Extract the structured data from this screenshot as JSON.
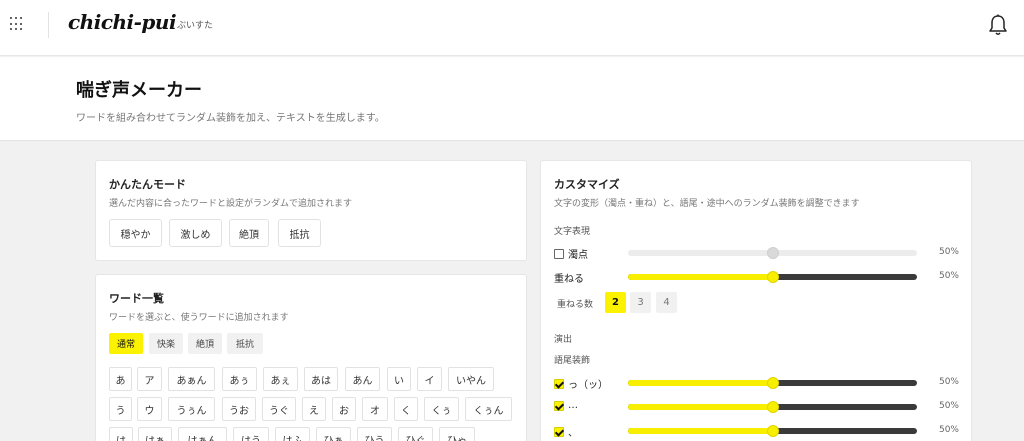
{
  "app": {
    "logo": "chichi-pui",
    "logo_sub": "ぶいすた"
  },
  "page": {
    "title": "喘ぎ声メーカー",
    "description": "ワードを組み合わせてランダム装飾を加え、テキストを生成します。"
  },
  "easy_mode": {
    "title": "かんたんモード",
    "description": "選んだ内容に合ったワードと設定がランダムで追加されます",
    "buttons": [
      "穏やか",
      "激しめ",
      "絶頂",
      "抵抗"
    ]
  },
  "word_list": {
    "title": "ワード一覧",
    "description": "ワードを選ぶと、使うワードに追加されます",
    "tabs": [
      "通常",
      "快楽",
      "絶頂",
      "抵抗"
    ],
    "active_tab": "通常",
    "rows": [
      [
        "あ",
        "ア",
        "あぁん",
        "あぅ",
        "あぇ",
        "あは",
        "あん",
        "い",
        "イ",
        "いやん"
      ],
      [
        "う",
        "ウ",
        "うぅん",
        "うお",
        "うぐ",
        "え",
        "お",
        "オ",
        "く",
        "くぅ",
        "くぅん"
      ],
      [
        "は",
        "はぁ",
        "はぁん",
        "はう",
        "はふ",
        "ひぁ",
        "ひう",
        "ひぐ",
        "ひゃ"
      ]
    ]
  },
  "customize": {
    "title": "カスタマイズ",
    "description": "文字の変形（濁点・重ね）と、語尾・途中へのランダム装飾を調整できます",
    "text_section": "文字表現",
    "dakuten": {
      "label": "濁点",
      "checked": false,
      "value": 50,
      "value_label": "50%"
    },
    "kasaneru": {
      "label": "重ねる",
      "value": 50,
      "value_label": "50%"
    },
    "count": {
      "label": "重ねる数",
      "options": [
        "2",
        "3",
        "4"
      ],
      "selected": "2"
    },
    "effects_section": "演出",
    "ending_section": "語尾装飾",
    "endings": [
      {
        "label": "っ（ッ）",
        "checked": true,
        "value": 50,
        "value_label": "50%"
      },
      {
        "label": "…",
        "checked": true,
        "value": 50,
        "value_label": "50%"
      },
      {
        "label": "、",
        "checked": true,
        "value": 50,
        "value_label": "50%"
      }
    ]
  }
}
